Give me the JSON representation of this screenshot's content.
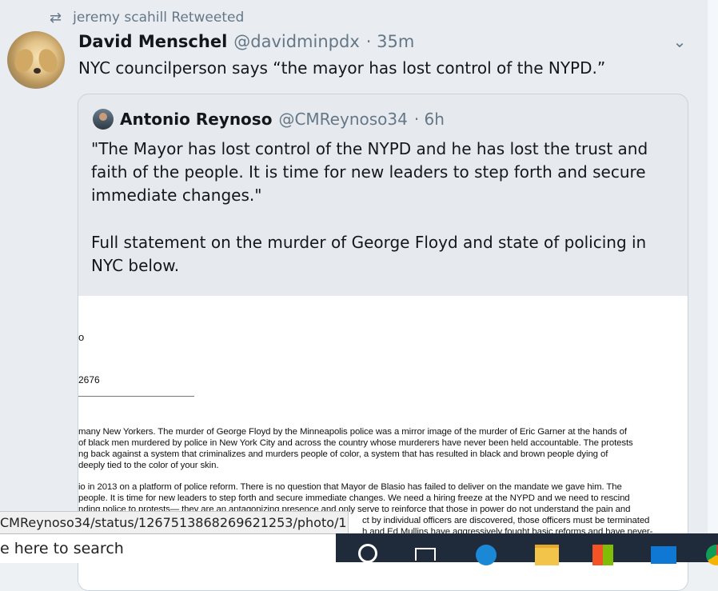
{
  "retweet_bar": {
    "icon": "retweet-icon",
    "text": "jeremy scahill Retweeted"
  },
  "tweet": {
    "author_name": "David Menschel",
    "handle": "@davidminpdx",
    "time": "· 35m",
    "text": "NYC councilperson says “the mayor has lost control of the NYPD.”",
    "menu_icon": "chevron-down-icon"
  },
  "quote": {
    "author_name": "Antonio Reynoso",
    "handle": "@CMReynoso34",
    "time": "· 6h",
    "paragraph1": "\"The Mayor has lost control of the NYPD and he has lost the trust and faith of the people. It is time for new leaders to step forth and secure immediate changes.\"",
    "paragraph2": "Full statement on the murder of George Floyd and state of policing in NYC below."
  },
  "document_image": {
    "fragment_top": "o",
    "fragment_phone": "2676",
    "paragraph1_lines": [
      "many New Yorkers. The murder of George Floyd by the Minneapolis police was a mirror image of the murder of Eric Garner at the hands of",
      "of black men murdered by police in New York City and across the country whose murderers have never been held accountable. The protests",
      "ng back against a system that criminalizes and murders people of color, a system that has resulted in black and brown people dying of",
      "deeply tied to the color of your skin."
    ],
    "paragraph2_lines": [
      "io in 2013 on a platform of police reform. There is no question that Mayor de Blasio has failed to deliver on the mandate we gave him. The",
      "people. It is time for new leaders to step forth and secure immediate changes. We need a hiring freeze at the NYPD and we need to rescind",
      "nding police to protests— they are an antagonizing presence and only serve to reinforce that those in power do not understand the pain and",
      "ct by individual officers are discovered, those officers must be terminated",
      "h and Ed Mullins have aggressively fought basic reforms and have never-"
    ]
  },
  "status_bar": {
    "url": "CMReynoso34/status/1267513868269621253/photo/1"
  },
  "taskbar": {
    "search_placeholder": "e here to search"
  }
}
